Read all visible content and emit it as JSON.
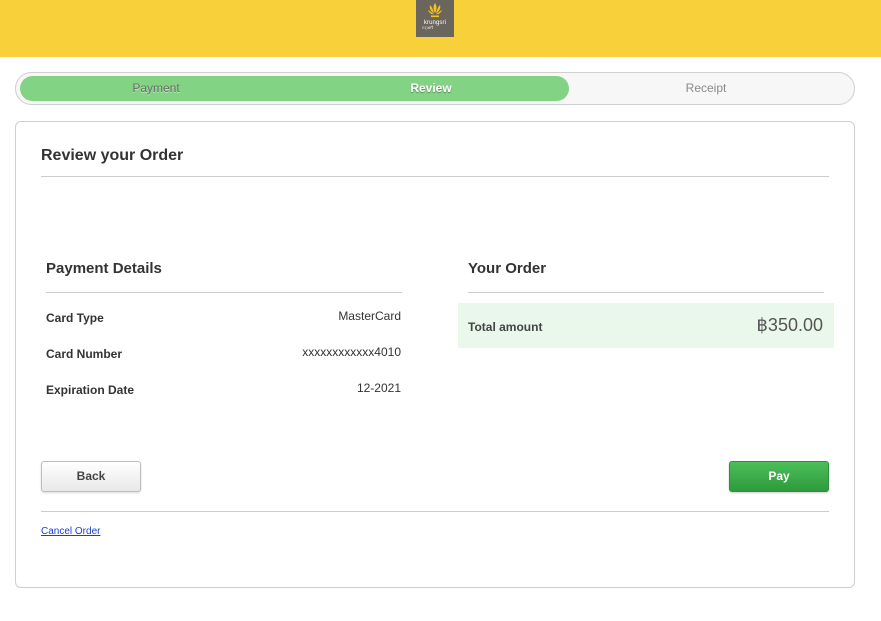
{
  "header": {
    "logo_text": "krungsri",
    "logo_subtext": "กรุงศรี"
  },
  "steps": [
    {
      "label": "Payment",
      "state": "done"
    },
    {
      "label": "Review",
      "state": "current"
    },
    {
      "label": "Receipt",
      "state": "upcoming"
    }
  ],
  "page": {
    "title": "Review your Order"
  },
  "payment_details": {
    "title": "Payment Details",
    "rows": [
      {
        "label": "Card Type",
        "value": "MasterCard"
      },
      {
        "label": "Card Number",
        "value": "xxxxxxxxxxxx4010"
      },
      {
        "label": "Expiration Date",
        "value": "12-2021"
      }
    ]
  },
  "order": {
    "title": "Your Order",
    "total_label": "Total amount",
    "total_amount": "฿350.00"
  },
  "actions": {
    "back_label": "Back",
    "pay_label": "Pay",
    "cancel_label": "Cancel Order"
  },
  "colors": {
    "header_bg": "#f8d03a",
    "progress_fill": "#83d385",
    "pay_button": "#3aaa48",
    "total_bg": "#eaf8ec"
  }
}
